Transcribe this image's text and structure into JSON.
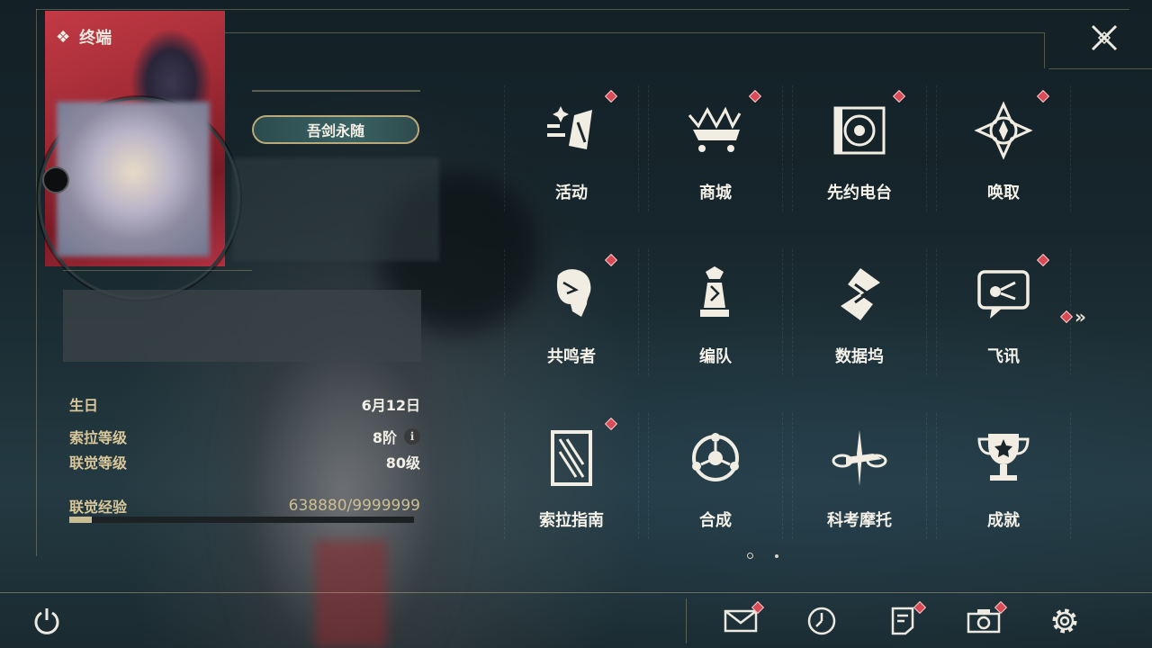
{
  "header": {
    "title": "终端"
  },
  "profile": {
    "title_badge": "吾剑永随",
    "info": [
      {
        "key": "生日",
        "value": "6月12日"
      },
      {
        "key": "索拉等级",
        "value": "8阶"
      },
      {
        "key": "联觉等级",
        "value": "80级"
      }
    ],
    "exp": {
      "label": "联觉经验",
      "value": "638880/9999999",
      "progress": 0.064
    }
  },
  "menu": {
    "items": [
      {
        "label": "活动",
        "icon": "activity-icon",
        "badge": true
      },
      {
        "label": "商城",
        "icon": "shop-crown-cart-icon",
        "badge": true
      },
      {
        "label": "先约电台",
        "icon": "radio-icon",
        "badge": true
      },
      {
        "label": "唤取",
        "icon": "summon-compass-icon",
        "badge": true
      },
      {
        "label": "共鸣者",
        "icon": "resonator-head-icon",
        "badge": true
      },
      {
        "label": "编队",
        "icon": "chess-team-icon",
        "badge": false
      },
      {
        "label": "数据坞",
        "icon": "data-dock-icon",
        "badge": false
      },
      {
        "label": "飞讯",
        "icon": "message-bubble-icon",
        "badge": true
      },
      {
        "label": "索拉指南",
        "icon": "guide-book-icon",
        "badge": true
      },
      {
        "label": "合成",
        "icon": "synthesis-icon",
        "badge": false
      },
      {
        "label": "科考摩托",
        "icon": "motorcycle-icon",
        "badge": false
      },
      {
        "label": "成就",
        "icon": "trophy-icon",
        "badge": false
      }
    ],
    "pages": 2,
    "current_page": 1
  },
  "bottom": {
    "buttons": [
      {
        "name": "mail-icon",
        "badge": true
      },
      {
        "name": "clock-icon",
        "badge": false
      },
      {
        "name": "notes-icon",
        "badge": true
      },
      {
        "name": "camera-icon",
        "badge": true
      },
      {
        "name": "settings-gear-icon",
        "badge": false
      }
    ]
  },
  "colors": {
    "accent": "#d9c79a",
    "badge": "#d84a55",
    "text": "#f4f1e8"
  }
}
